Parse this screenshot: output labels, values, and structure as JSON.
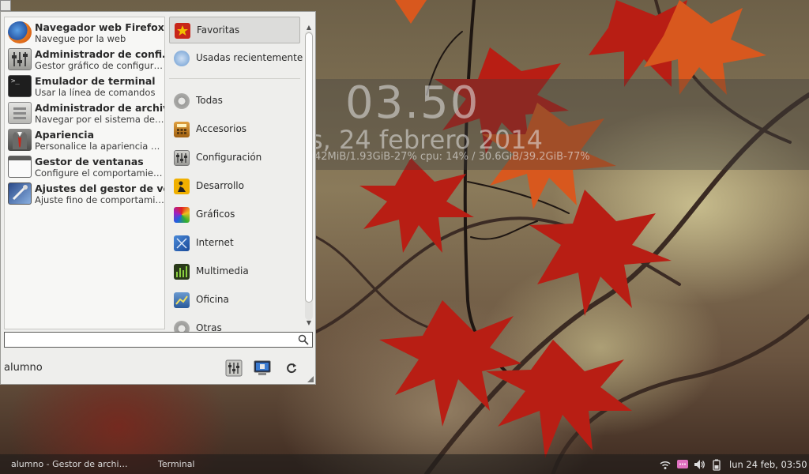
{
  "conky": {
    "clock": "03.50",
    "date": "s, 24 febrero 2014",
    "stats": "42MiB/1.93GiB-27% cpu: 14% / 30.6GiB/39.2GiB-77%"
  },
  "menu": {
    "apps": [
      {
        "name": "Navegador web Firefox",
        "desc": "Navegue por la web",
        "icon": "firefox-icon"
      },
      {
        "name": "Administrador de confi…",
        "desc": "Gestor gráfico de configur…",
        "icon": "settings-editor-icon"
      },
      {
        "name": "Emulador de terminal",
        "desc": "Usar la línea de comandos",
        "icon": "terminal-icon"
      },
      {
        "name": "Administrador de archiv…",
        "desc": "Navegar por el sistema de…",
        "icon": "file-manager-icon"
      },
      {
        "name": "Apariencia",
        "desc": "Personalice la apariencia …",
        "icon": "appearance-icon"
      },
      {
        "name": "Gestor de ventanas",
        "desc": "Configure el comportamie…",
        "icon": "window-manager-icon"
      },
      {
        "name": "Ajustes del gestor de ve…",
        "desc": "Ajuste fino de comportami…",
        "icon": "window-tweaks-icon"
      }
    ],
    "categories": [
      {
        "label": "Favoritas",
        "icon": "favorites-icon"
      },
      {
        "label": "Usadas recientemente",
        "icon": "recent-icon"
      },
      {
        "label": "Todas",
        "icon": "all-apps-icon"
      },
      {
        "label": "Accesorios",
        "icon": "accessories-icon"
      },
      {
        "label": "Configuración",
        "icon": "settings-icon"
      },
      {
        "label": "Desarrollo",
        "icon": "development-icon"
      },
      {
        "label": "Gráficos",
        "icon": "graphics-icon"
      },
      {
        "label": "Internet",
        "icon": "internet-icon"
      },
      {
        "label": "Multimedia",
        "icon": "multimedia-icon"
      },
      {
        "label": "Oficina",
        "icon": "office-icon"
      },
      {
        "label": "Otras",
        "icon": "other-icon"
      }
    ],
    "search_value": "",
    "username": "alumno"
  },
  "taskbar": {
    "tasks": [
      "alumno - Gestor de archi…",
      "Terminal"
    ],
    "clock": "lun 24 feb, 03:50"
  },
  "colors": {
    "leaf_red": "#c8261a",
    "leaf_orange": "#d9541e",
    "menu_bg": "#eeeeec"
  }
}
